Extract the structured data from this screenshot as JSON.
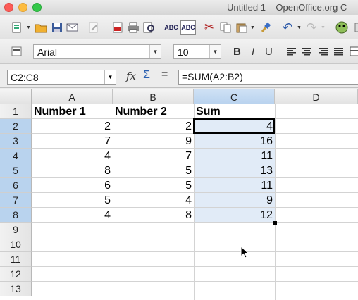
{
  "window": {
    "title": "Untitled 1 – OpenOffice.org C"
  },
  "toolbar1": {
    "icons": [
      "new-document-icon",
      "open-folder-icon",
      "save-icon",
      "email-icon",
      "edit-file-icon",
      "export-pdf-icon",
      "print-icon",
      "print-preview-icon",
      "spellcheck-icon",
      "autospellcheck-icon",
      "cut-icon",
      "copy-icon",
      "paste-icon",
      "format-paintbrush-icon",
      "undo-icon",
      "redo-icon",
      "navigator-icon"
    ]
  },
  "toolbar2": {
    "font_name": "Arial",
    "font_size": "10",
    "bold": "B",
    "italic": "I",
    "underline": "U"
  },
  "formula_bar": {
    "name_box": "C2:C8",
    "formula": "=SUM(A2:B2)"
  },
  "grid": {
    "columns": [
      "A",
      "B",
      "C",
      "D"
    ],
    "rows": [
      "1",
      "2",
      "3",
      "4",
      "5",
      "6",
      "7",
      "8",
      "9",
      "10",
      "11",
      "12",
      "13"
    ],
    "selected_column": "C",
    "selected_rows": [
      "2",
      "3",
      "4",
      "5",
      "6",
      "7",
      "8"
    ],
    "header_row": [
      "Number 1",
      "Number 2",
      "Sum"
    ],
    "data": [
      [
        "2",
        "2",
        "4"
      ],
      [
        "7",
        "9",
        "16"
      ],
      [
        "4",
        "7",
        "11"
      ],
      [
        "8",
        "5",
        "13"
      ],
      [
        "6",
        "5",
        "11"
      ],
      [
        "5",
        "4",
        "9"
      ],
      [
        "4",
        "8",
        "12"
      ]
    ]
  },
  "colors": {
    "selection": "#e1ebf7",
    "header_selection": "#b9d3ee",
    "sigma": "#2a5fb0"
  }
}
